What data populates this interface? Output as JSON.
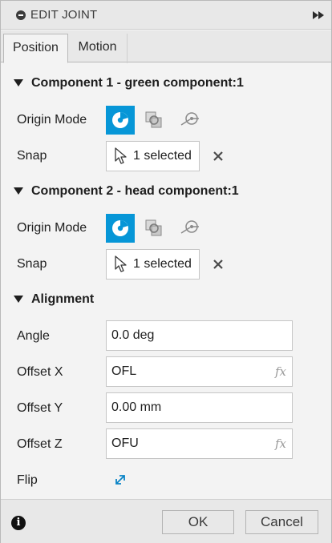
{
  "dialog": {
    "title": "EDIT JOINT"
  },
  "tabs": [
    {
      "label": "Position",
      "active": true
    },
    {
      "label": "Motion",
      "active": false
    }
  ],
  "component1": {
    "title": "Component 1 - green component:1",
    "origin_mode_label": "Origin Mode",
    "snap_label": "Snap",
    "snap_value": "1 selected"
  },
  "component2": {
    "title": "Component 2 - head component:1",
    "origin_mode_label": "Origin Mode",
    "snap_label": "Snap",
    "snap_value": "1 selected"
  },
  "alignment": {
    "title": "Alignment",
    "angle": {
      "label": "Angle",
      "value": "0.0 deg"
    },
    "offset_x": {
      "label": "Offset X",
      "value": "OFL",
      "fx": "fx"
    },
    "offset_y": {
      "label": "Offset Y",
      "value": "0.00 mm"
    },
    "offset_z": {
      "label": "Offset Z",
      "value": "OFU",
      "fx": "fx"
    },
    "flip_label": "Flip"
  },
  "footer": {
    "ok_label": "OK",
    "cancel_label": "Cancel",
    "info_glyph": "i"
  },
  "icons": {
    "collapse": "minus-circle-icon",
    "expand_panel": "fast-forward-icon",
    "origin_simple": "origin-simple-icon",
    "origin_between_planes": "between-planes-icon",
    "origin_two_edges": "two-edge-intersection-icon",
    "snap_cursor": "cursor-arrow-icon",
    "clear": "close-icon",
    "flip": "flip-arrows-icon",
    "info": "info-icon"
  },
  "colors": {
    "accent": "#0696d7",
    "panel": "#f3f3f3",
    "header": "#e8e8e8"
  }
}
